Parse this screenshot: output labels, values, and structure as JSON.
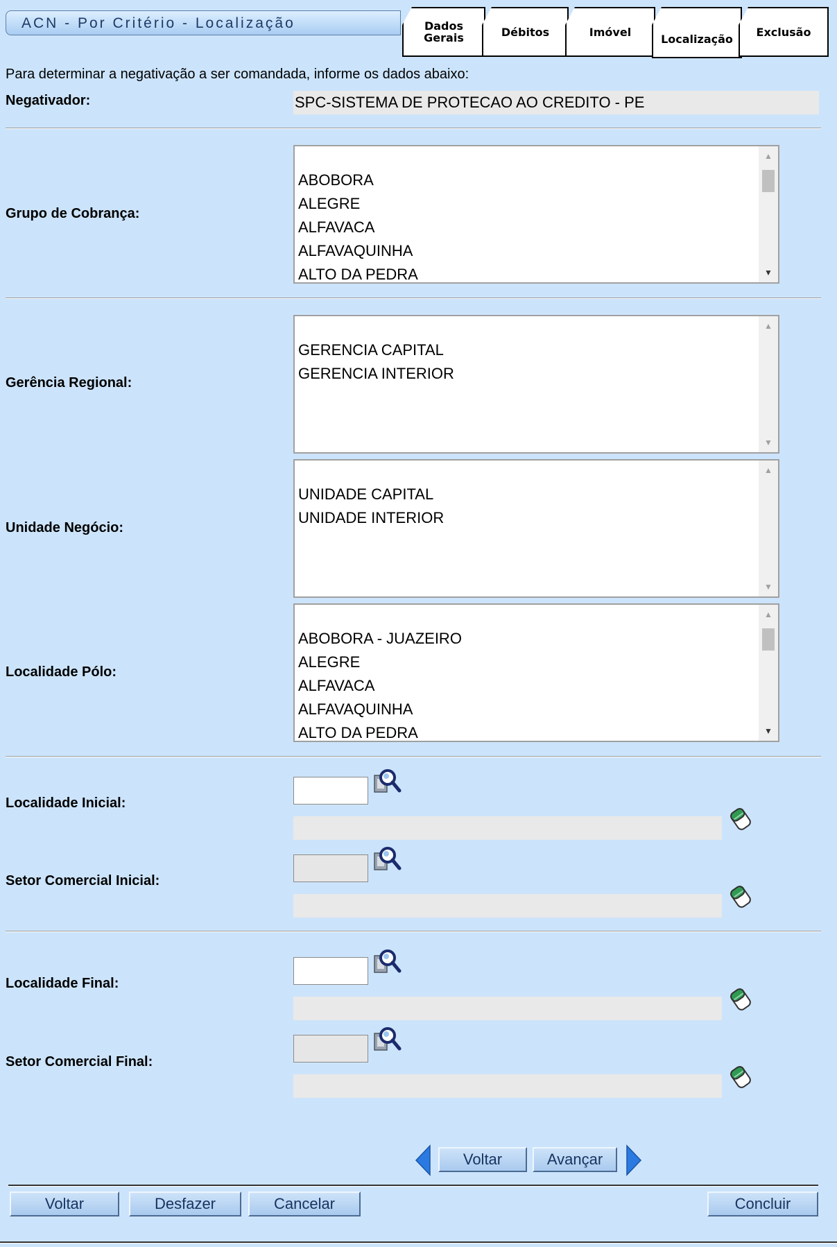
{
  "header": {
    "title": "ACN - Por Critério - Localização",
    "tabs": [
      {
        "label_1": "Dados",
        "label_2": "Gerais"
      },
      {
        "label_1": "Débitos"
      },
      {
        "label_1": "Imóvel"
      },
      {
        "label_1": "Localização"
      },
      {
        "label_1": "Exclusão"
      }
    ]
  },
  "form": {
    "intro": "Para determinar a negativação a ser comandada, informe os dados abaixo:",
    "negativador_label": "Negativador:",
    "negativador_value": "SPC-SISTEMA DE PROTECAO AO CREDITO - PE",
    "grupo_label": "Grupo de Cobrança:",
    "grupo_options": [
      "ABOBORA",
      "ALEGRE",
      "ALFAVACA",
      "ALFAVAQUINHA",
      "ALTO DA PEDRA"
    ],
    "gerencia_label": "Gerência Regional:",
    "gerencia_options": [
      "GERENCIA CAPITAL",
      "GERENCIA INTERIOR"
    ],
    "unidade_label": "Unidade Negócio:",
    "unidade_options": [
      "UNIDADE CAPITAL",
      "UNIDADE INTERIOR"
    ],
    "localidade_polo_label": "Localidade Pólo:",
    "localidade_polo_options": [
      "ABOBORA - JUAZEIRO",
      "ALEGRE",
      "ALFAVACA",
      "ALFAVAQUINHA",
      "ALTO DA PEDRA"
    ],
    "localidade_inicial_label": "Localidade Inicial:",
    "setor_inicial_label": "Setor Comercial Inicial:",
    "localidade_final_label": "Localidade Final:",
    "setor_final_label": "Setor Comercial Final:"
  },
  "nav": {
    "voltar": "Voltar",
    "avancar": "Avançar"
  },
  "footer": {
    "voltar": "Voltar",
    "desfazer": "Desfazer",
    "cancelar": "Cancelar",
    "concluir": "Concluir"
  },
  "icons": {
    "search": "search-icon",
    "eraser": "eraser-icon",
    "arrow_left": "arrow-left-icon",
    "arrow_right": "arrow-right-icon"
  },
  "colors": {
    "background": "#cce4fb",
    "field_readonly": "#e9e9e9",
    "button_text": "#17335f",
    "arrow": "#2a7ae2"
  }
}
